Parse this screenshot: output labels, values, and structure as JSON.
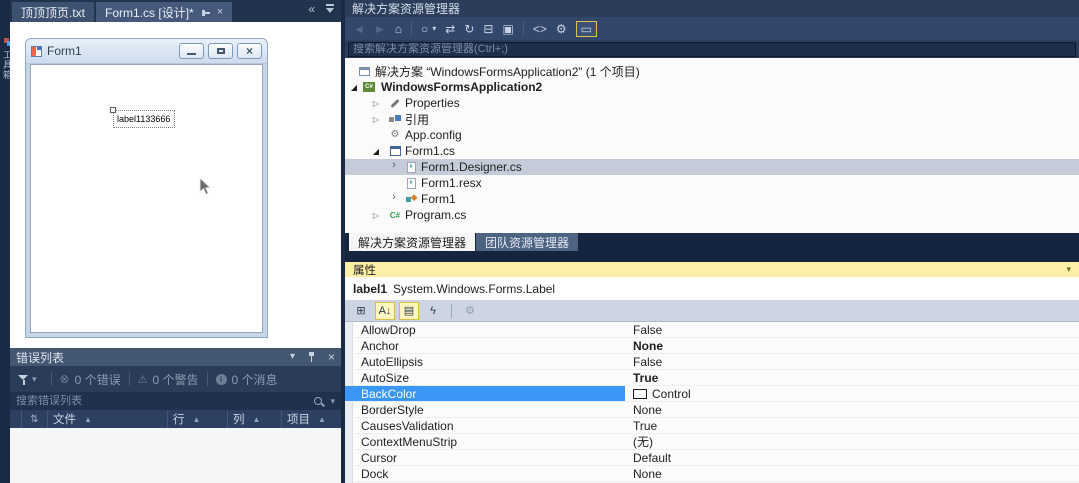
{
  "left_strip": {
    "tab_label": "工具箱"
  },
  "doc_well": {
    "tabs": [
      {
        "label": "顶顶顶页.txt"
      },
      {
        "label": "Form1.cs [设计]*"
      }
    ],
    "scroll_left_glyph": "«",
    "tab_close_glyph": "×"
  },
  "designer": {
    "form": {
      "title": "Form1",
      "label_text": "label1133666"
    }
  },
  "error_list": {
    "title": "错误列表",
    "title_icons": {
      "menu": "▾",
      "close": "×"
    },
    "toolbar": {
      "errors": "0 个错误",
      "warnings": "0 个警告",
      "messages": "0 个消息",
      "error_glyph": "⊗",
      "warning_glyph": "⚠"
    },
    "search_placeholder": "搜索错误列表",
    "columns": {
      "order_glyph": "⇅",
      "file": "文件",
      "line": "行",
      "column": "列",
      "project": "项目"
    }
  },
  "solution_explorer": {
    "title": "解决方案资源管理器",
    "search_placeholder": "搜索解决方案资源管理器(Ctrl+;)",
    "toolbar": [
      {
        "name": "back",
        "glyph": "◄"
      },
      {
        "name": "forward",
        "glyph": "►"
      },
      {
        "name": "home",
        "glyph": "⌂"
      },
      {
        "name": "pending-changes-filter",
        "glyph": "○"
      },
      {
        "name": "filter-dropdown",
        "glyph": "▾"
      },
      {
        "name": "sync-with-active-document",
        "glyph": "⇄"
      },
      {
        "name": "refresh",
        "glyph": "↻"
      },
      {
        "name": "collapse-all",
        "glyph": "⊟"
      },
      {
        "name": "show-all-files",
        "glyph": "▣"
      },
      {
        "name": "view-code",
        "glyph": "<>"
      },
      {
        "name": "properties",
        "glyph": "⚙"
      },
      {
        "name": "preview-selected-items",
        "glyph": "▭"
      }
    ],
    "tree": [
      {
        "label": "解决方案 “WindowsFormsApplication2” (1 个项目)"
      },
      {
        "label": "WindowsFormsApplication2"
      },
      {
        "label": "Properties"
      },
      {
        "label": "引用"
      },
      {
        "label": "App.config"
      },
      {
        "label": "Form1.cs"
      },
      {
        "label": "Form1.Designer.cs"
      },
      {
        "label": "Form1.resx"
      },
      {
        "label": "Form1"
      },
      {
        "label": "Program.cs"
      },
      {
        "csproj_badge": "C#",
        "csgreen_badge": "C#",
        "csfile_badge": "#"
      }
    ],
    "footer_tabs": [
      {
        "label": "解决方案资源管理器"
      },
      {
        "label": "团队资源管理器"
      }
    ]
  },
  "properties_panel": {
    "title": "属性",
    "title_caret": "▾",
    "object_name": "label1",
    "object_type": "System.Windows.Forms.Label",
    "toolbar": [
      {
        "name": "categorized",
        "glyph": "⊞"
      },
      {
        "name": "alphabetical",
        "glyph": "A↓"
      },
      {
        "name": "properties",
        "glyph": "▤"
      },
      {
        "name": "events",
        "glyph": "ϟ"
      },
      {
        "name": "property-pages",
        "glyph": "⚙"
      }
    ],
    "rows": [
      {
        "name": "AllowDrop",
        "value": "False"
      },
      {
        "name": "Anchor",
        "value": "None"
      },
      {
        "name": "AutoEllipsis",
        "value": "False"
      },
      {
        "name": "AutoSize",
        "value": "True"
      },
      {
        "name": "BackColor",
        "value": "Control"
      },
      {
        "name": "BorderStyle",
        "value": "None"
      },
      {
        "name": "CausesValidation",
        "value": "True"
      },
      {
        "name": "ContextMenuStrip",
        "value": "(无)"
      },
      {
        "name": "Cursor",
        "value": "Default"
      },
      {
        "name": "Dock",
        "value": "None"
      }
    ]
  },
  "colors": {
    "selection_blue": "#3A96F5",
    "active_panel_title": "#FBF0A5",
    "chrome": "#1B2A44",
    "back_color_swatch": "#FFFFFF"
  }
}
